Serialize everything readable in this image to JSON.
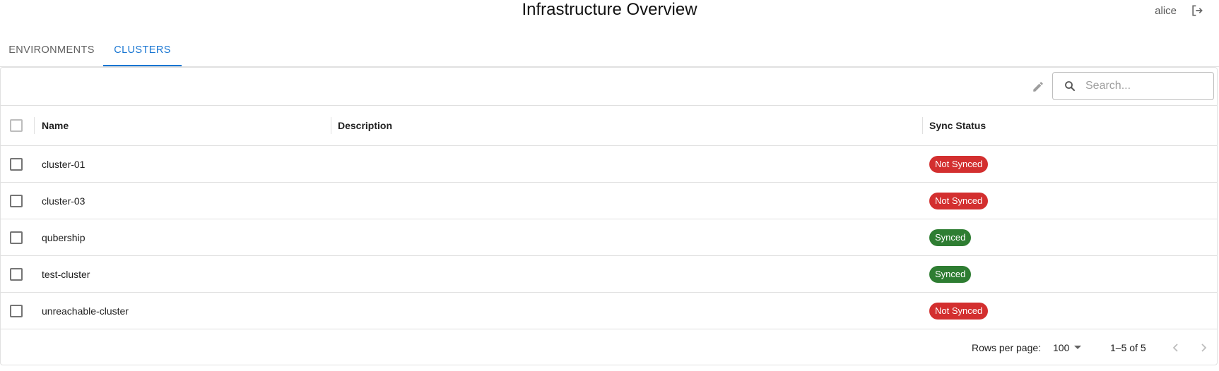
{
  "header": {
    "title": "Infrastructure Overview",
    "username": "alice",
    "logout_icon": "logout-icon"
  },
  "tabs": [
    {
      "label": "ENVIRONMENTS",
      "active": false
    },
    {
      "label": "CLUSTERS",
      "active": true
    }
  ],
  "toolbar": {
    "edit_icon": "pencil-icon",
    "search_placeholder": "Search...",
    "search_value": ""
  },
  "table": {
    "columns": [
      "Name",
      "Description",
      "Sync Status"
    ],
    "rows": [
      {
        "name": "cluster-01",
        "description": "",
        "status": "Not Synced",
        "status_type": "not-synced"
      },
      {
        "name": "cluster-03",
        "description": "",
        "status": "Not Synced",
        "status_type": "not-synced"
      },
      {
        "name": "qubership",
        "description": "",
        "status": "Synced",
        "status_type": "synced"
      },
      {
        "name": "test-cluster",
        "description": "",
        "status": "Synced",
        "status_type": "synced"
      },
      {
        "name": "unreachable-cluster",
        "description": "",
        "status": "Not Synced",
        "status_type": "not-synced"
      }
    ]
  },
  "pagination": {
    "rows_per_page_label": "Rows per page:",
    "rows_per_page_value": "100",
    "range": "1–5 of 5"
  },
  "colors": {
    "accent": "#1976d2",
    "not_synced": "#d32f2f",
    "synced": "#2e7d32"
  }
}
